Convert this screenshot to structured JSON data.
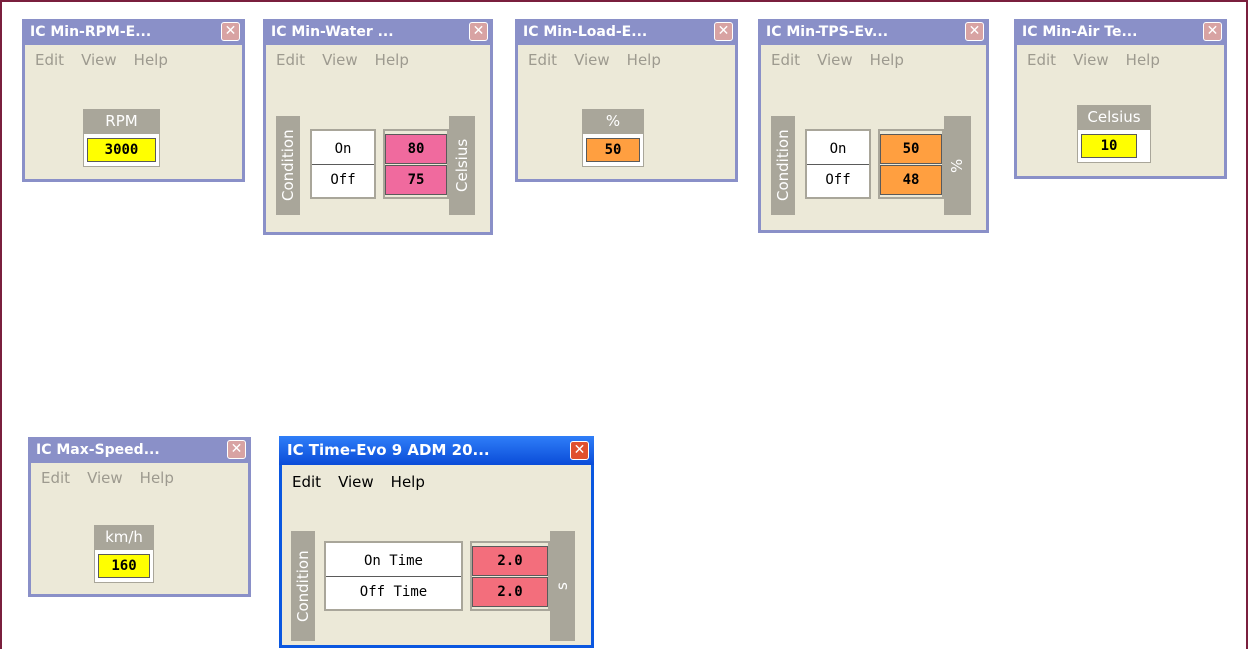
{
  "colors": {
    "yellow": "#ffff00",
    "orange": "#ff9f40",
    "pink": "#f06a9e",
    "rose": "#f36e7c",
    "inactive_title": "#8a90c8",
    "active_title": "#0a4cd8"
  },
  "windows": [
    {
      "title": "IC Min-RPM-E...",
      "menu": [
        "Edit",
        "View",
        "Help"
      ],
      "unit": "RPM",
      "value": "3000",
      "value_color": "yellow"
    },
    {
      "title": "IC Min-Water ...",
      "menu": [
        "Edit",
        "View",
        "Help"
      ],
      "condition_label": "Condition",
      "rows": [
        "On",
        "Off"
      ],
      "values": [
        "80",
        "75"
      ],
      "unit": "Celsius",
      "value_color": "pink"
    },
    {
      "title": "IC Min-Load-E...",
      "menu": [
        "Edit",
        "View",
        "Help"
      ],
      "unit": "%",
      "value": "50",
      "value_color": "orange"
    },
    {
      "title": "IC Min-TPS-Ev...",
      "menu": [
        "Edit",
        "View",
        "Help"
      ],
      "condition_label": "Condition",
      "rows": [
        "On",
        "Off"
      ],
      "values": [
        "50",
        "48"
      ],
      "unit": "%",
      "value_color": "orange"
    },
    {
      "title": "IC Min-Air Te...",
      "menu": [
        "Edit",
        "View",
        "Help"
      ],
      "unit": "Celsius",
      "value": "10",
      "value_color": "yellow"
    },
    {
      "title": "IC Max-Speed...",
      "menu": [
        "Edit",
        "View",
        "Help"
      ],
      "unit": "km/h",
      "value": "160",
      "value_color": "yellow"
    },
    {
      "title": "IC Time-Evo 9 ADM 20...",
      "active": true,
      "menu": [
        "Edit",
        "View",
        "Help"
      ],
      "condition_label": "Condition",
      "rows": [
        "On Time",
        "Off Time"
      ],
      "values": [
        "2.0",
        "2.0"
      ],
      "unit": "s",
      "value_color": "rose"
    }
  ],
  "close_glyph": "✕"
}
